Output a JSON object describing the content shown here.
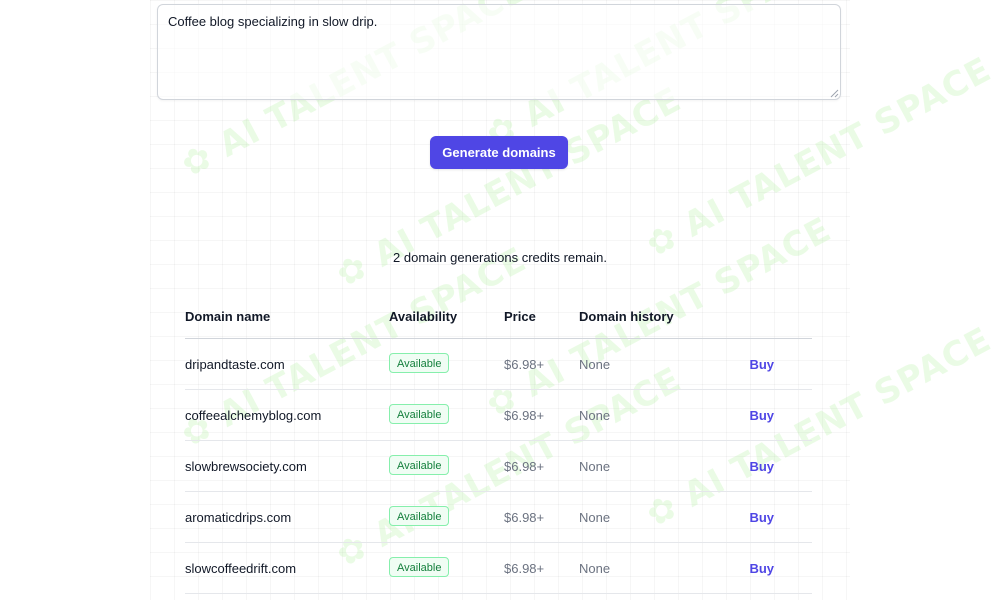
{
  "prompt": {
    "value": "Coffee blog specializing in slow drip."
  },
  "generate_button": {
    "label": "Generate domains"
  },
  "credits_text": "2 domain generations credits remain.",
  "watermark_text": "AI TALENT SPACE",
  "colors": {
    "accent": "#4f46e5",
    "available_text": "#15803d",
    "available_bg": "#f0fdf4",
    "available_border": "#86efac"
  },
  "table": {
    "headers": {
      "domain": "Domain name",
      "availability": "Availability",
      "price": "Price",
      "history": "Domain history"
    },
    "rows": [
      {
        "domain": "dripandtaste.com",
        "availability": "Available",
        "price": "$6.98+",
        "history": "None",
        "action": "Buy"
      },
      {
        "domain": "coffeealchemyblog.com",
        "availability": "Available",
        "price": "$6.98+",
        "history": "None",
        "action": "Buy"
      },
      {
        "domain": "slowbrewsociety.com",
        "availability": "Available",
        "price": "$6.98+",
        "history": "None",
        "action": "Buy"
      },
      {
        "domain": "aromaticdrips.com",
        "availability": "Available",
        "price": "$6.98+",
        "history": "None",
        "action": "Buy"
      },
      {
        "domain": "slowcoffeedrift.com",
        "availability": "Available",
        "price": "$6.98+",
        "history": "None",
        "action": "Buy"
      }
    ]
  }
}
